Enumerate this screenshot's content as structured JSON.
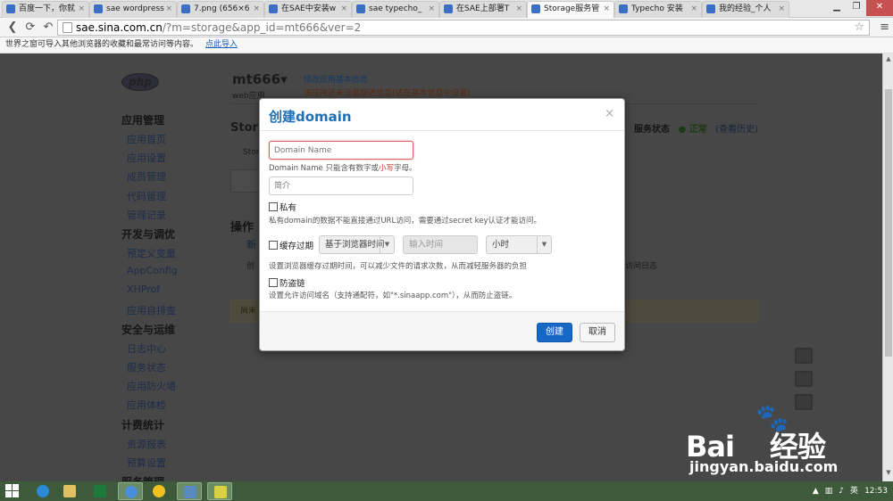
{
  "browser": {
    "tabs": [
      {
        "label": "百度一下，你就"
      },
      {
        "label": "sae wordpress"
      },
      {
        "label": "7.png (656×6"
      },
      {
        "label": "在SAE中安装w"
      },
      {
        "label": "sae typecho_"
      },
      {
        "label": "在SAE上部署T"
      },
      {
        "label": "Storage服务管"
      },
      {
        "label": "Typecho 安装"
      },
      {
        "label": "我的经验_个人"
      }
    ],
    "active_tab_index": 6,
    "url_domain": "sae.sina.com.cn",
    "url_rest": "/?m=storage&app_id=mt666&ver=2",
    "infobar_text": "世界之窗可导入其他浏览器的收藏和最常访问等内容。",
    "infobar_link": "点此导入"
  },
  "app": {
    "logo_text": "php",
    "name": "mt666▾",
    "type": "web应用",
    "edit_info": "修改应用基本信息",
    "description": "该应用还未设置描述信息(请在基本信息中设置)"
  },
  "sidebar": [
    {
      "heading": "应用管理",
      "items": [
        "应用首页",
        "应用设置",
        "成员管理",
        "代码管理",
        "管理记录"
      ]
    },
    {
      "heading": "开发与调优",
      "items": [
        "预定义变量",
        "AppConfig",
        "XHProf",
        "应用自排查"
      ]
    },
    {
      "heading": "安全与运维",
      "items": [
        "日志中心",
        "服务状态",
        "应用防火墙",
        "应用体检"
      ]
    },
    {
      "heading": "计费统计",
      "items": [
        "资源报表",
        "预算设置"
      ]
    },
    {
      "heading": "服务管理",
      "items": []
    }
  ],
  "main": {
    "title": "Stor",
    "service_status_label": "服务状态",
    "service_status_value": "正常",
    "history_link": "(查看历史)",
    "tab_label": "Stor",
    "ops_heading": "操作",
    "new_link": "新",
    "ops_desc": "创",
    "log_text": "访问日志",
    "notice": "尚未"
  },
  "modal": {
    "title": "创建domain",
    "close": "×",
    "domain_placeholder": "Domain Name",
    "domain_help_prefix": "Domain Name 只能含有数字或",
    "domain_help_red": "小写",
    "domain_help_suffix": "字母。",
    "desc_placeholder": "简介",
    "private_label": "私有",
    "private_help": "私有domain的数据不能直接通过URL访问，需要通过secret key认证才能访问。",
    "cache_label": "缓存过期",
    "cache_base_select": "基于浏览器时间",
    "cache_time_placeholder": "输入时间",
    "cache_unit_select": "小时",
    "cache_help": "设置浏览器缓存过期时间，可以减少文件的请求次数，从而减轻服务器的负担",
    "hotlink_label": "防盗链",
    "hotlink_help": "设置允许访问域名（支持通配符，如\"*.sinaapp.com\"），从而防止盗链。",
    "create_button": "创建",
    "cancel_button": "取消"
  },
  "taskbar": {
    "time": "12:53",
    "ime": "英"
  },
  "watermark": {
    "brand": "Bai",
    "brand2": "经验",
    "site": "jingyan.baidu.com"
  },
  "colors": {
    "accent": "#1e6fb5",
    "primary_button": "#1667c6",
    "error_border": "#e06060",
    "help_red": "#d03030"
  }
}
